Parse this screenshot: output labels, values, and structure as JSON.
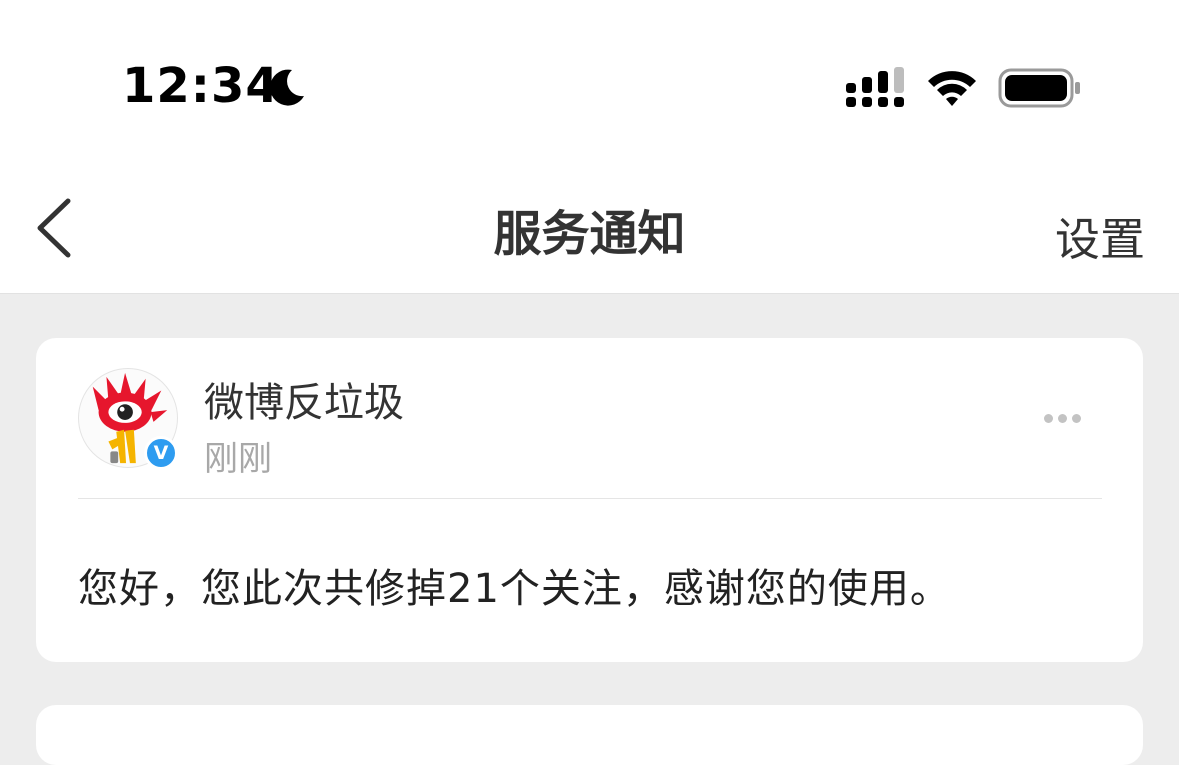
{
  "status_bar": {
    "time": "12:34",
    "icons": [
      "moon-icon",
      "cellular-signal-icon",
      "wifi-icon",
      "battery-icon"
    ]
  },
  "nav": {
    "title": "服务通知",
    "action_label": "设置",
    "back_icon": "chevron-left-icon"
  },
  "notification": {
    "sender": "微博反垃圾",
    "time": "刚刚",
    "verified_badge": "V",
    "message": "您好，您此次共修掉21个关注，感谢您的使用。",
    "more_icon": "more-horizontal-icon"
  },
  "colors": {
    "background": "#ededed",
    "card": "#ffffff",
    "verified_blue": "#2e9cf0",
    "logo_red": "#e6162d",
    "logo_yellow": "#f5b400"
  }
}
